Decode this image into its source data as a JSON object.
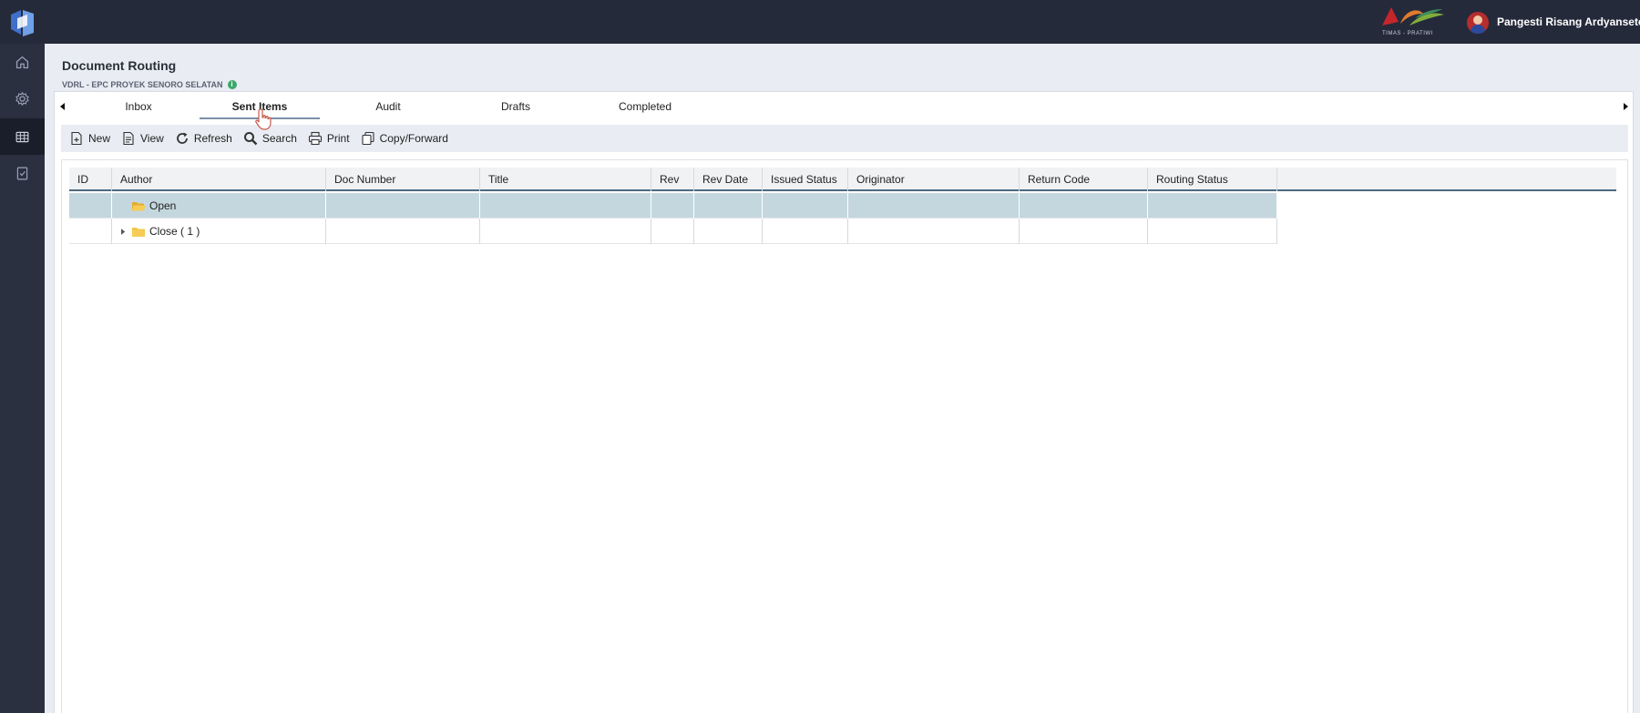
{
  "header": {
    "brand_text": "TIMAS - PRATIWI",
    "user_name": "Pangesti Risang Ardyanseto"
  },
  "sidebar": {
    "items": [
      {
        "icon": "home-icon"
      },
      {
        "icon": "gear-icon"
      },
      {
        "icon": "grid-icon",
        "active": true
      },
      {
        "icon": "document-check-icon"
      }
    ]
  },
  "page": {
    "title": "Document Routing",
    "subtitle": "VDRL - EPC PROYEK SENORO SELATAN"
  },
  "tabs": [
    {
      "label": "Inbox"
    },
    {
      "label": "Sent Items",
      "active": true
    },
    {
      "label": "Audit"
    },
    {
      "label": "Drafts"
    },
    {
      "label": "Completed"
    }
  ],
  "toolbar": {
    "new": "New",
    "view": "View",
    "refresh": "Refresh",
    "search": "Search",
    "print": "Print",
    "copy_forward": "Copy/Forward"
  },
  "grid": {
    "columns": [
      "ID",
      "Author",
      "Doc Number",
      "Title",
      "Rev",
      "Rev Date",
      "Issued Status",
      "Originator",
      "Return Code",
      "Routing Status"
    ],
    "rows": [
      {
        "label": "Open",
        "expandable": false,
        "selected": true
      },
      {
        "label": "Close ( 1 )",
        "expandable": true,
        "selected": false
      }
    ]
  },
  "colors": {
    "topbar": "#252a3b",
    "sidebar": "#2a3040",
    "selected_row": "#c4d7de",
    "header_underline": "#4c6a7e",
    "folder": "#f3c544"
  }
}
